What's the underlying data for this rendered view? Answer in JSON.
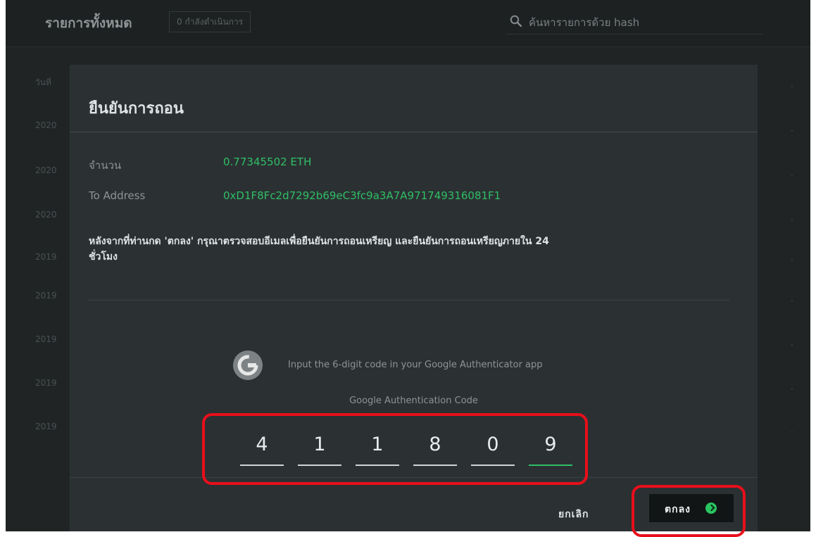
{
  "background": {
    "title": "รายการทั้งหมด",
    "pending_badge": "0 กำลังดำเนินการ",
    "search_placeholder": "ค้นหารายการด้วย hash",
    "column_date_header": "วันที่",
    "date_prefixes": [
      "2020",
      "2020",
      "2020",
      "2019",
      "2019",
      "2019",
      "2019",
      "2019"
    ]
  },
  "modal": {
    "title": "ยืนยันการถอน",
    "amount_label": "จำนวน",
    "amount_value": "0.77345502 ETH",
    "address_label": "To Address",
    "address_value": "0xD1F8Fc2d7292b69eC3fc9a3A7A971749316081F1",
    "notice_line_1": "หลังจากที่ท่านกด 'ตกลง' กรุณาตรวจสอบอีเมลเพื่อยืนยันการถอนเหรียญ และยืนยันการถอนเหรียญภายใน 24",
    "notice_line_2": "ชั่วโมง",
    "authenticator_instruction": "Input the 6-digit code in your Google Authenticator app",
    "code_label": "Google Authentication Code",
    "digits": [
      "4",
      "1",
      "1",
      "8",
      "0",
      "9"
    ],
    "cancel_label": "ยกเลิก",
    "confirm_label": "ตกลง"
  },
  "colors": {
    "accent_green": "#2fbf66",
    "highlight_red": "#e80f1b",
    "modal_background": "#2b3133"
  }
}
